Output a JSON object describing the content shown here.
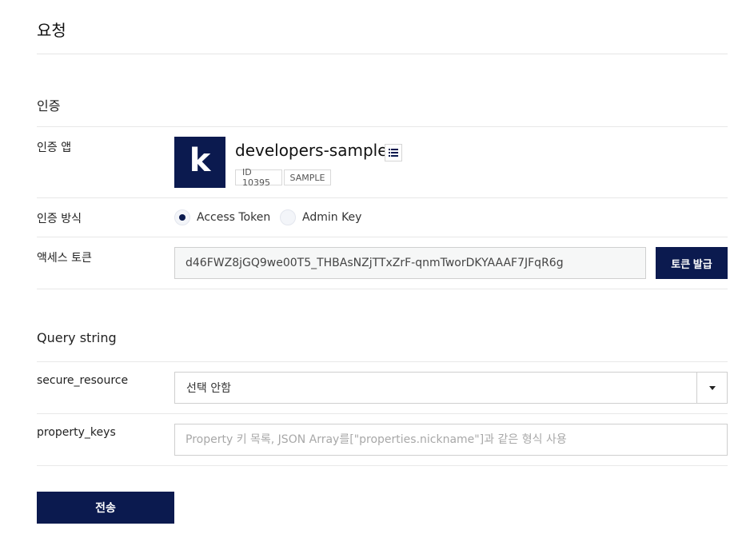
{
  "page": {
    "title": "요청"
  },
  "auth": {
    "section_title": "인증",
    "app_label": "인증 앱",
    "app": {
      "logo_letter": "k",
      "name": "developers-sample",
      "tags": [
        "ID 10395",
        "SAMPLE"
      ]
    },
    "method_label": "인증 방식",
    "methods": [
      {
        "label": "Access Token",
        "selected": true
      },
      {
        "label": "Admin Key",
        "selected": false
      }
    ],
    "token_label": "액세스 토큰",
    "token_value": "d46FWZ8jGQ9we00T5_THBAsNZjTTxZrF-qnmTworDKYAAAF7JFqR6g",
    "issue_button": "토큰 발급"
  },
  "query": {
    "section_title": "Query string",
    "secure_resource": {
      "label": "secure_resource",
      "selected": "선택 안함"
    },
    "property_keys": {
      "label": "property_keys",
      "placeholder": "Property 키 목록, JSON Array를[\"properties.nickname\"]과 같은 형식 사용",
      "value": ""
    }
  },
  "submit_button": "전송",
  "colors": {
    "brand": "#0b1a4f",
    "border": "#cfcfcf",
    "divider": "#e8e8e8"
  },
  "icons": [
    "list-icon",
    "chevron-down-icon"
  ]
}
